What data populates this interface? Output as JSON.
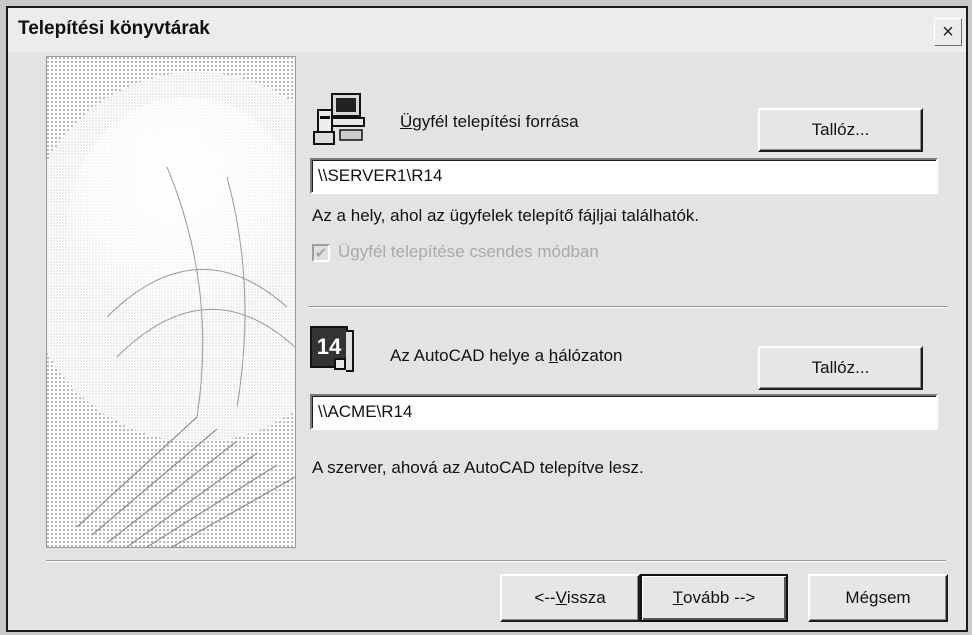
{
  "window": {
    "title": "Telepítési könyvtárak",
    "close_label": "×"
  },
  "client": {
    "label_pre": "",
    "label_accel": "Ü",
    "label_post": "gyfél telepítési forrása",
    "browse_label": "Tallóz...",
    "path_value": "\\\\SERVER1\\R14",
    "help_text": "Az a hely, ahol az ügyfelek telepítő fájljai találhatók.",
    "silent_checkbox_label": "Ügyfél telepítése csendes módban",
    "silent_checked": true,
    "icon": "client-computer-icon"
  },
  "server": {
    "label_pre": "Az AutoCAD helye a ",
    "label_accel": "h",
    "label_post": "álózaton",
    "browse_label": "Tallóz...",
    "path_value": "\\\\ACME\\R14",
    "help_text": "A szerver, ahová az AutoCAD telepítve lesz.",
    "icon_text": "14",
    "icon": "autocad-r14-icon"
  },
  "footer": {
    "back_pre": "<--",
    "back_accel": "V",
    "back_post": "issza",
    "next_accel": "T",
    "next_post": "ovább -->",
    "cancel_label": "Mégsem"
  }
}
